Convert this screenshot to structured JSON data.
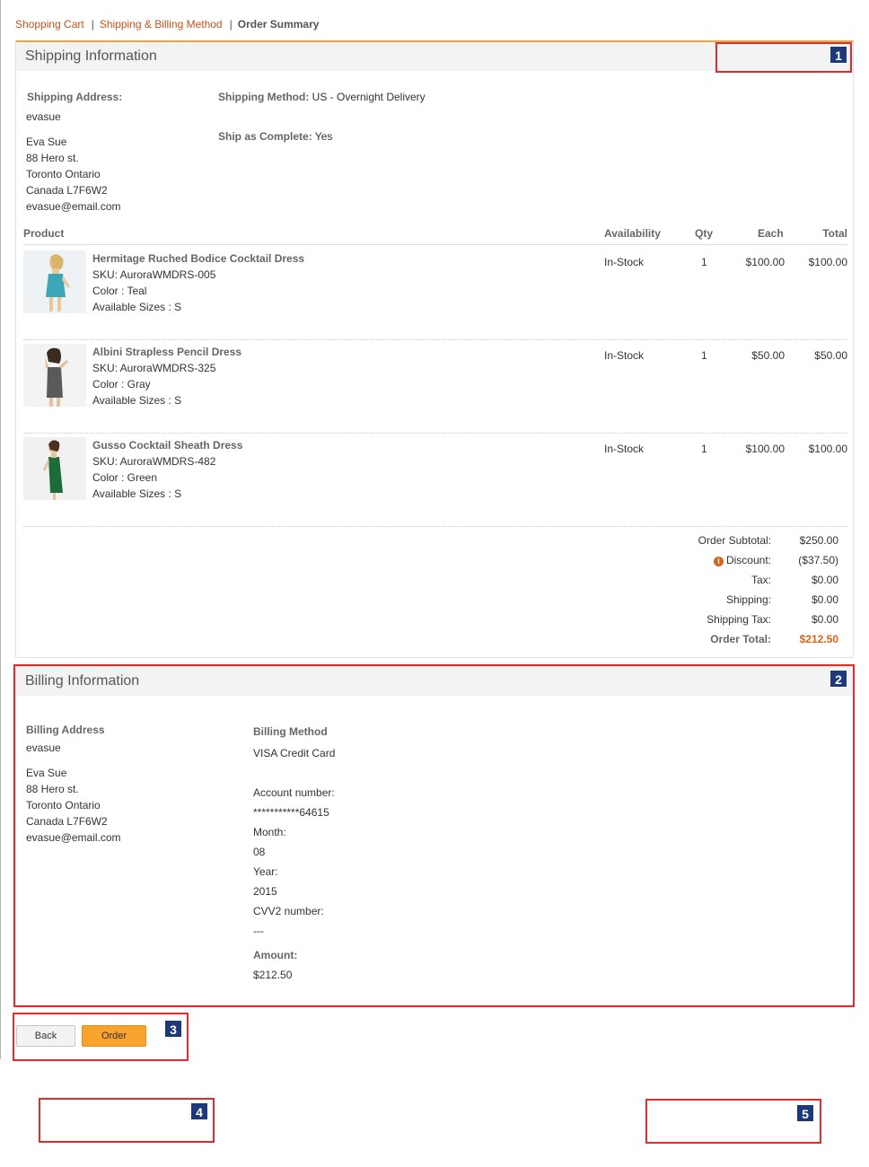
{
  "breadcrumb": {
    "shopping_cart": "Shopping Cart",
    "shipping_billing": "Shipping & Billing Method",
    "order_summary": "Order Summary",
    "separator": "|"
  },
  "shipping": {
    "title": "Shipping Information",
    "address_label": "Shipping Address:",
    "username": "evasue",
    "name": "Eva Sue",
    "street": "88 Hero st.",
    "city": "Toronto Ontario",
    "country_postal": "Canada L7F6W2",
    "email": "evasue@email.com",
    "method_label": "Shipping Method:",
    "method_value": " US - Overnight Delivery",
    "complete_label": "Ship as Complete:",
    "complete_value": " Yes"
  },
  "table": {
    "headers": {
      "product": "Product",
      "availability": "Availability",
      "qty": "Qty",
      "each": "Each",
      "total": "Total"
    },
    "rows": [
      {
        "name": "Hermitage Ruched Bodice Cocktail Dress",
        "sku": "SKU: AuroraWMDRS-005",
        "color": "Color : Teal",
        "sizes": "Available Sizes : S",
        "availability": "In-Stock",
        "qty": "1",
        "each": "$100.00",
        "total": "$100.00",
        "dress_color": "#3aa6b8"
      },
      {
        "name": "Albini Strapless Pencil Dress",
        "sku": "SKU: AuroraWMDRS-325",
        "color": "Color : Gray",
        "sizes": "Available Sizes : S",
        "availability": "In-Stock",
        "qty": "1",
        "each": "$50.00",
        "total": "$50.00",
        "dress_color": "#5a5a5a"
      },
      {
        "name": "Gusso Cocktail Sheath Dress",
        "sku": "SKU: AuroraWMDRS-482",
        "color": "Color : Green",
        "sizes": "Available Sizes : S",
        "availability": "In-Stock",
        "qty": "1",
        "each": "$100.00",
        "total": "$100.00",
        "dress_color": "#1d6b3a"
      }
    ]
  },
  "totals": {
    "subtotal_label": "Order Subtotal:",
    "subtotal_value": "$250.00",
    "discount_label": "Discount:",
    "discount_value": "($37.50)",
    "tax_label": "Tax:",
    "tax_value": "$0.00",
    "shipping_label": "Shipping:",
    "shipping_value": "$0.00",
    "shipping_tax_label": "Shipping Tax:",
    "shipping_tax_value": "$0.00",
    "order_total_label": "Order Total:",
    "order_total_value": "$212.50",
    "info_icon": "i"
  },
  "billing": {
    "title": "Billing Information",
    "address_label": "Billing Address",
    "username": "evasue",
    "name": "Eva Sue",
    "street": "88 Hero st.",
    "city": "Toronto Ontario",
    "country_postal": "Canada L7F6W2",
    "email": "evasue@email.com",
    "method_label": "Billing Method",
    "method_value": "VISA Credit Card",
    "account_label": "Account number:",
    "account_value": "***********64615",
    "month_label": "Month:",
    "month_value": "08",
    "year_label": "Year:",
    "year_value": "2015",
    "cvv_label": "CVV2 number:",
    "cvv_value": "---",
    "amount_label": "Amount:",
    "amount_value": "$212.50"
  },
  "buttons": {
    "back": "Back",
    "order": "Order"
  },
  "callouts": [
    "1",
    "2",
    "3",
    "4",
    "5"
  ],
  "colors": {
    "link": "#c8521a",
    "accent_orange": "#f7a32e",
    "total_orange": "#d9641c",
    "callout_red": "#e22b2b",
    "badge_navy": "#1c3a7a"
  }
}
